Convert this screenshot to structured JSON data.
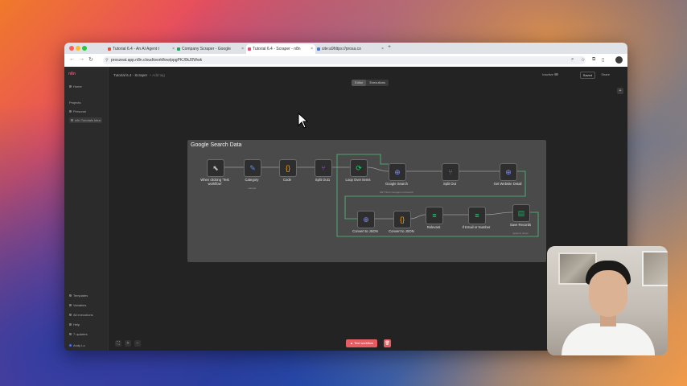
{
  "browser": {
    "tabs": [
      {
        "label": "Tutorial 6.4 - An AI Agent t",
        "color": "#e0533a"
      },
      {
        "label": "Company Scraper - Google",
        "color": "#1ea362"
      },
      {
        "label": "Tutorial 6.4 - Scraper - n8n",
        "color": "#ea4b71",
        "active": true
      },
      {
        "label": "site:a9https://prosa.co",
        "color": "#4a7bd0"
      }
    ],
    "url": "proszeat.app.n8n.cloud/workflow/ppgPKJ0kJ0Wwk"
  },
  "sidebar": {
    "logo": "n8n",
    "items": [
      "Home",
      "Projects",
      "Personal",
      "n8n Tutorials Idea"
    ],
    "bottom_items": [
      "Templates",
      "Variables",
      "All executions",
      "Help",
      "7 updates"
    ],
    "user": "Andy Lo"
  },
  "header": {
    "breadcrumb": "Tutorial 6.4 - Scraper",
    "tag": "+ Add tag",
    "toggle": [
      "Editor",
      "Executions"
    ],
    "active_label": "Inactive",
    "saved": "Saved",
    "share": "Share"
  },
  "group": {
    "title": "Google Search Data",
    "nodes": [
      {
        "label": "When clicking 'Test workflow'",
        "sub": "",
        "icon": "cursor-icon",
        "glyph": "⬉",
        "color": "#bbbbbb"
      },
      {
        "label": "Category",
        "sub": "manual",
        "icon": "pencil-icon",
        "glyph": "✎",
        "color": "#5a8dee"
      },
      {
        "label": "Code",
        "sub": "",
        "icon": "code-braces-icon",
        "glyph": "{}",
        "color": "#f39c12"
      },
      {
        "label": "Split Out1",
        "sub": "",
        "icon": "split-icon",
        "glyph": "⑂",
        "color": "#9b59d0"
      },
      {
        "label": "Loop Over Items",
        "sub": "",
        "icon": "loop-icon",
        "glyph": "⟳",
        "color": "#2ecc71"
      },
      {
        "label": "Google Search",
        "sub": "GET https://serpapi.com/search",
        "icon": "globe-icon",
        "glyph": "⊕",
        "color": "#7b8cf0"
      },
      {
        "label": "Split Out",
        "sub": "",
        "icon": "split-icon",
        "glyph": "⑂",
        "color": "#9b59d0"
      },
      {
        "label": "Get Website Detail",
        "sub": "",
        "icon": "globe-icon",
        "glyph": "⊕",
        "color": "#7b8cf0"
      },
      {
        "label": "Convert to JSON",
        "sub": "",
        "icon": "globe-icon",
        "glyph": "⊕",
        "color": "#7b8cf0"
      },
      {
        "label": "Convert to JSON",
        "sub": "",
        "icon": "code-braces-icon",
        "glyph": "{}",
        "color": "#f39c12"
      },
      {
        "label": "Relevant",
        "sub": "",
        "icon": "filter-icon",
        "glyph": "≡",
        "color": "#2ecc71"
      },
      {
        "label": "If Email or Number",
        "sub": "",
        "icon": "filter-icon",
        "glyph": "≡",
        "color": "#2ecc71"
      },
      {
        "label": "Save Records",
        "sub": "append: sheet",
        "icon": "sheets-icon",
        "glyph": "▤",
        "color": "#21a464"
      }
    ]
  },
  "footer": {
    "execute_label": "Test workflow",
    "trash": "🗑"
  }
}
